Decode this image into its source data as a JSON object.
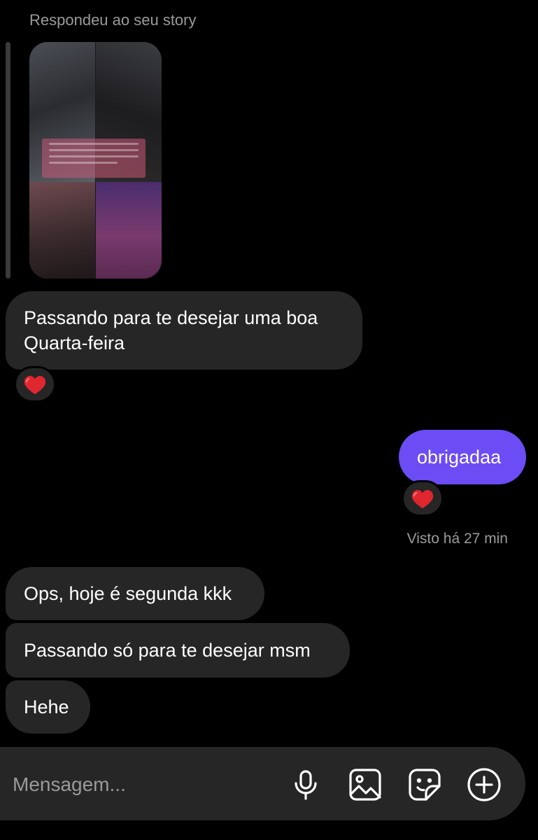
{
  "story_reply": {
    "caption": "Respondeu ao seu story"
  },
  "messages": [
    {
      "direction": "incoming",
      "text": "Passando para te desejar uma boa\nQuarta-feira",
      "reaction": "heart"
    },
    {
      "direction": "outgoing",
      "text": "obrigadaa",
      "reaction": "heart"
    },
    {
      "direction": "incoming",
      "text": "Ops, hoje é segunda kkk"
    },
    {
      "direction": "incoming",
      "text": "Passando só para te desejar msm"
    },
    {
      "direction": "incoming",
      "text": "Hehe"
    }
  ],
  "seen_status": "Visto há 27 min",
  "composer": {
    "placeholder": "Mensagem...",
    "icons": [
      "microphone-icon",
      "gallery-icon",
      "sticker-icon",
      "plus-icon"
    ]
  },
  "colors": {
    "background": "#000000",
    "incoming_bubble": "#262626",
    "outgoing_bubble": "#6c4cf5",
    "muted_text": "#9a9a9a",
    "reaction_heart": "#e0262f"
  }
}
